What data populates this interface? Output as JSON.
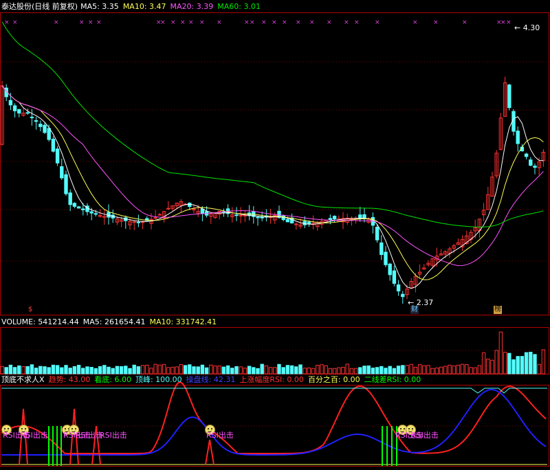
{
  "colors": {
    "up": "#ff3232",
    "down": "#54fcfc",
    "ma5": "#ffffff",
    "ma10": "#ffff54",
    "ma20": "#ff54ff",
    "ma60": "#00e600",
    "frame": "#b00000",
    "grid": "#800000"
  },
  "header": {
    "title": "泰达股份(日线 前复权)",
    "ma5_label": "MA5: 3.35",
    "ma10_label": "MA10: 3.47",
    "ma20_label": "MA20: 3.39",
    "ma60_label": "MA60: 3.01"
  },
  "price_panel": {
    "high_label": "4.30",
    "low_label": "2.37",
    "badge_cai": "财",
    "badge_bang": "榜",
    "badge_dollar": "$",
    "mark_glyph": "×"
  },
  "volume_panel": {
    "volume_label": "VOLUME: 541214.44",
    "ma5_label": "MA5: 261654.41",
    "ma10_label": "MA10: 331742.41"
  },
  "indicator_panel": {
    "name": "顶底不求人X",
    "trend_label": "趋势: 43.00",
    "bottom_label": "看底: 6.00",
    "top_label": "顶峰: 100.00",
    "control_label": "操盘线: 42.31",
    "rsi_up_label": "上涨幅度RSI: 0.00",
    "percent_label": "百分之百: 0.00",
    "diff_label": "二线差RSI: 0.00",
    "rsi_out": "RSI出击"
  },
  "chart_data": {
    "type": "candlestick",
    "price_range": [
      2.3,
      4.42
    ],
    "high": 4.3,
    "low": 2.37
  }
}
